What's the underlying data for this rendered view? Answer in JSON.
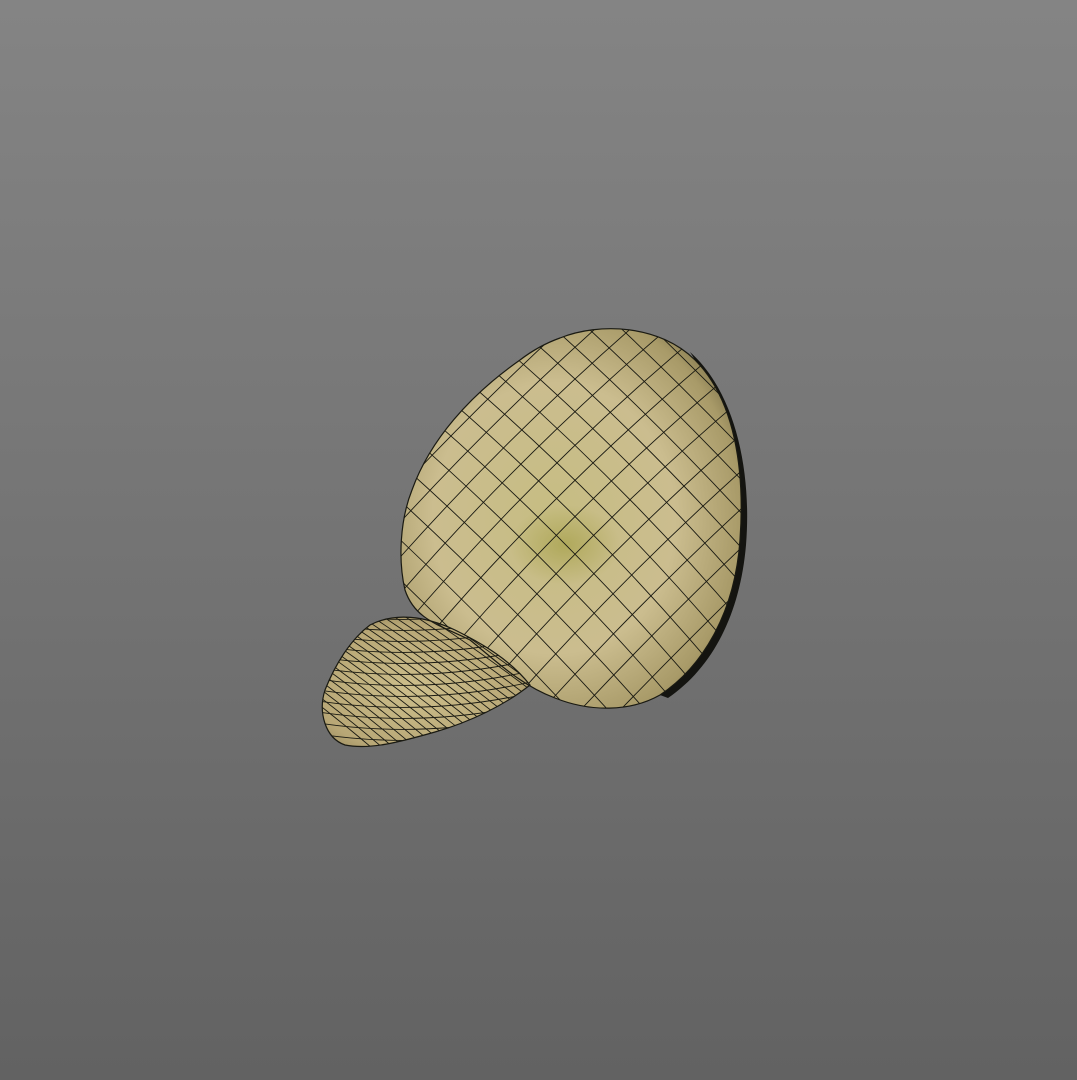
{
  "viewport": {
    "background_top": "#848484",
    "background_bottom": "#626262"
  },
  "model": {
    "shape_icon": "wireframe-seed-model-icon",
    "surface_color": "#c9b98a",
    "surface_highlight": "#e6dbb4",
    "surface_shadow": "#6e6440",
    "wire_color": "#1a1a12",
    "rim_color": "#141410"
  }
}
